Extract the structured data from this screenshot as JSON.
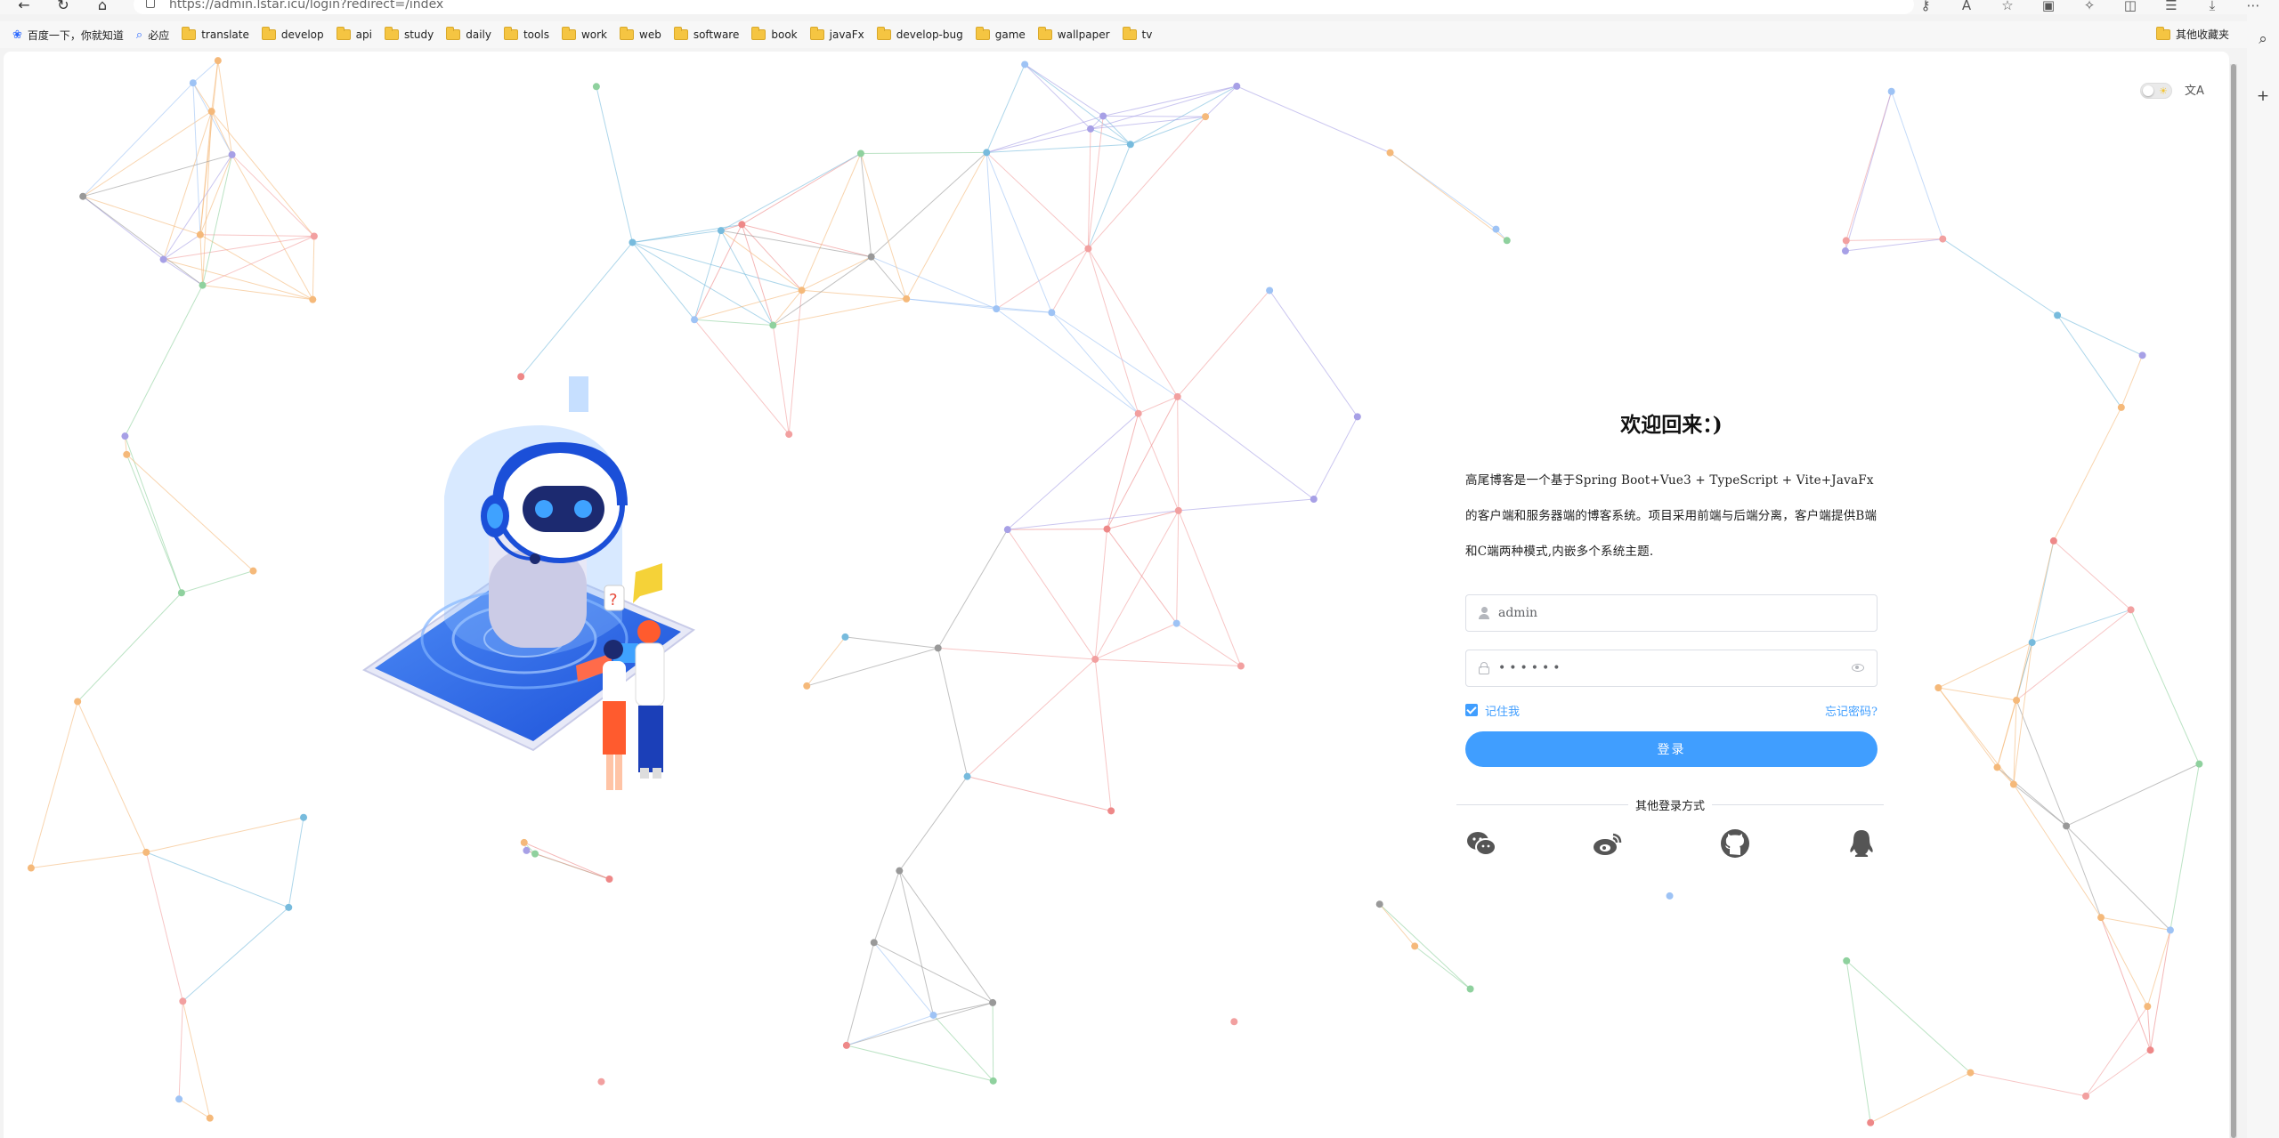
{
  "browser": {
    "url": "https://admin.lstar.icu/login?redirect=/index",
    "bookmarks": [
      {
        "label": "百度一下，你就知道",
        "icon": "baidu-paw-icon"
      },
      {
        "label": "必应",
        "icon": "bing-search-icon"
      },
      {
        "label": "translate",
        "icon": "folder-icon"
      },
      {
        "label": "develop",
        "icon": "folder-icon"
      },
      {
        "label": "api",
        "icon": "folder-icon"
      },
      {
        "label": "study",
        "icon": "folder-icon"
      },
      {
        "label": "daily",
        "icon": "folder-icon"
      },
      {
        "label": "tools",
        "icon": "folder-icon"
      },
      {
        "label": "work",
        "icon": "folder-icon"
      },
      {
        "label": "web",
        "icon": "folder-icon"
      },
      {
        "label": "software",
        "icon": "folder-icon"
      },
      {
        "label": "book",
        "icon": "folder-icon"
      },
      {
        "label": "javaFx",
        "icon": "folder-icon"
      },
      {
        "label": "develop-bug",
        "icon": "folder-icon"
      },
      {
        "label": "game",
        "icon": "folder-icon"
      },
      {
        "label": "wallpaper",
        "icon": "folder-icon"
      },
      {
        "label": "tv",
        "icon": "folder-icon"
      }
    ],
    "other_bookmarks": "其他收藏夹"
  },
  "login": {
    "title": "欢迎回来：)",
    "description": "高尾博客是一个基于Spring Boot+Vue3 + TypeScript + Vite+JavaFx的客户端和服务器端的博客系统。项目采用前端与后端分离，客户端提供B端和C端两种模式,内嵌多个系统主题.",
    "username_value": "admin",
    "password_value": "••••••",
    "remember_label": "记住我",
    "remember_checked": true,
    "forgot_label": "忘记密码?",
    "submit_label": "登录",
    "other_methods_label": "其他登录方式",
    "social_icons": [
      "wechat-icon",
      "weibo-icon",
      "github-icon",
      "qq-icon"
    ]
  },
  "theme": {
    "accent": "#409eff",
    "toggle_icon": "sun-icon",
    "translate_icon": "translate-icon"
  }
}
